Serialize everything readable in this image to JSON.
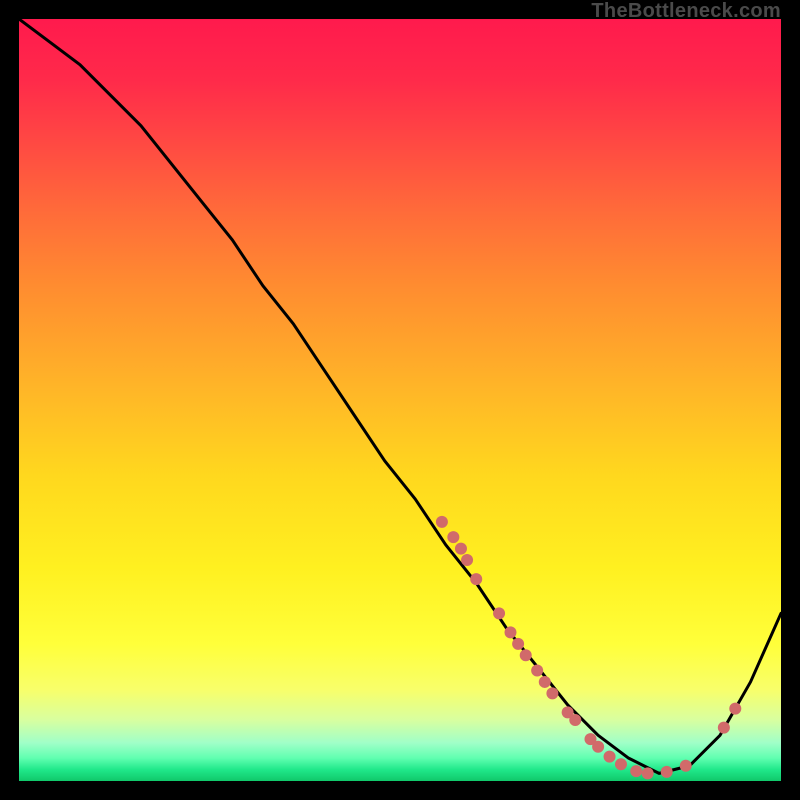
{
  "watermark": "TheBottleneck.com",
  "chart_data": {
    "type": "line",
    "title": "",
    "xlabel": "",
    "ylabel": "",
    "xlim": [
      0,
      100
    ],
    "ylim": [
      0,
      100
    ],
    "grid": false,
    "series": [
      {
        "name": "bottleneck-curve",
        "x": [
          0,
          4,
          8,
          12,
          16,
          20,
          24,
          28,
          32,
          36,
          40,
          44,
          48,
          52,
          56,
          60,
          64,
          68,
          72,
          76,
          80,
          84,
          88,
          92,
          96,
          100
        ],
        "y": [
          100,
          97,
          94,
          90,
          86,
          81,
          76,
          71,
          65,
          60,
          54,
          48,
          42,
          37,
          31,
          26,
          20,
          15,
          10,
          6,
          3,
          1,
          2,
          6,
          13,
          22
        ],
        "color": "#000000",
        "stroke_width": 3
      }
    ],
    "scatter_points": {
      "name": "markers",
      "color": "#d16a6a",
      "radius": 6,
      "points": [
        {
          "x": 55.5,
          "y": 34
        },
        {
          "x": 57.0,
          "y": 32
        },
        {
          "x": 58.0,
          "y": 30.5
        },
        {
          "x": 58.8,
          "y": 29
        },
        {
          "x": 60.0,
          "y": 26.5
        },
        {
          "x": 63.0,
          "y": 22
        },
        {
          "x": 64.5,
          "y": 19.5
        },
        {
          "x": 65.5,
          "y": 18
        },
        {
          "x": 66.5,
          "y": 16.5
        },
        {
          "x": 68.0,
          "y": 14.5
        },
        {
          "x": 69.0,
          "y": 13
        },
        {
          "x": 70.0,
          "y": 11.5
        },
        {
          "x": 72.0,
          "y": 9
        },
        {
          "x": 73.0,
          "y": 8
        },
        {
          "x": 75.0,
          "y": 5.5
        },
        {
          "x": 76.0,
          "y": 4.5
        },
        {
          "x": 77.5,
          "y": 3.2
        },
        {
          "x": 79.0,
          "y": 2.2
        },
        {
          "x": 81.0,
          "y": 1.3
        },
        {
          "x": 82.5,
          "y": 1.0
        },
        {
          "x": 85.0,
          "y": 1.2
        },
        {
          "x": 87.5,
          "y": 2.0
        },
        {
          "x": 92.5,
          "y": 7.0
        },
        {
          "x": 94.0,
          "y": 9.5
        }
      ]
    },
    "background_gradient": {
      "stops": [
        {
          "pos": 0,
          "color": "#ff1a4d"
        },
        {
          "pos": 50,
          "color": "#ffd020"
        },
        {
          "pos": 85,
          "color": "#ffff50"
        },
        {
          "pos": 100,
          "color": "#10c86a"
        }
      ]
    }
  }
}
